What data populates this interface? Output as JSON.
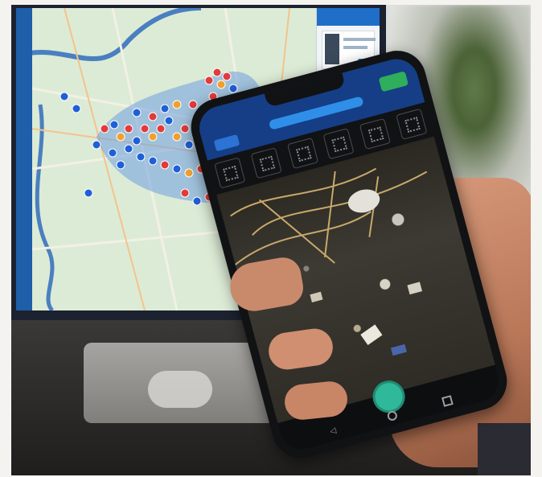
{
  "scene": {
    "subject": "photo",
    "colors": {
      "app_header": "#153e86",
      "ok_button": "#2fae5b",
      "capture_button": "#2fb89a",
      "map_water": "#4a7fc0",
      "map_land": "#dcebd6",
      "point_blue": "#1f5fd8",
      "point_red": "#e23b3b",
      "point_orange": "#f0a030"
    }
  }
}
